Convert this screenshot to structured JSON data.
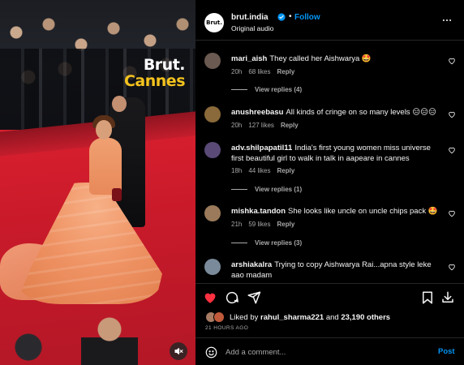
{
  "media": {
    "brand_name": "Brut.",
    "brand_sub": "Cannes",
    "mute_icon": "speaker-muted-icon"
  },
  "header": {
    "avatar_text": "Brut.",
    "username": "brut.india",
    "separator": "•",
    "follow_label": "Follow",
    "audio": "Original audio",
    "more_icon": "more-horizontal-icon"
  },
  "comments": [
    {
      "username": "mari_aish",
      "text": "They called her Aishwarya 🤩",
      "time": "20h",
      "likes": "68 likes",
      "reply": "Reply",
      "view_replies": "View replies (4)",
      "avatar_color": "#6b5a52"
    },
    {
      "username": "anushreebasu",
      "text": "All kinds of cringe on so many levels 😑😑😑",
      "time": "20h",
      "likes": "127 likes",
      "reply": "Reply",
      "view_replies": "",
      "avatar_color": "#8a6a3a"
    },
    {
      "username": "adv.shilpapatil11",
      "text": "India's first young women miss universe first beautiful girl to walk in talk in aapeare in cannes",
      "time": "18h",
      "likes": "44 likes",
      "reply": "Reply",
      "view_replies": "View replies (1)",
      "avatar_color": "#5a4a78"
    },
    {
      "username": "mishka.tandon",
      "text": "She looks like uncle on uncle chips pack 🤩",
      "time": "21h",
      "likes": "59 likes",
      "reply": "Reply",
      "view_replies": "View replies (3)",
      "avatar_color": "#9a7a5a"
    },
    {
      "username": "arshiakalra",
      "text": "Trying to copy Aishwarya Rai...apna style leke aao madam",
      "time": "",
      "likes": "",
      "reply": "",
      "view_replies": "",
      "avatar_color": "#7a8a9a"
    }
  ],
  "actions": {
    "like_icon": "heart-filled-icon",
    "comment_icon": "comment-icon",
    "share_icon": "share-icon",
    "save_icon": "bookmark-icon",
    "download_icon": "download-icon",
    "like_color": "#ff3040"
  },
  "likes": {
    "prefix": "Liked by",
    "user": "rahul_sharma221",
    "middle": "and",
    "others": "23,190 others"
  },
  "time_ago": "21 HOURS AGO",
  "add_comment": {
    "placeholder": "Add a comment...",
    "post_label": "Post",
    "emoji_icon": "smiley-icon"
  },
  "colors": {
    "accent": "#0095f6",
    "brand_yellow": "#f4c31e",
    "background": "#000000",
    "muted_text": "#a8a8a8"
  }
}
